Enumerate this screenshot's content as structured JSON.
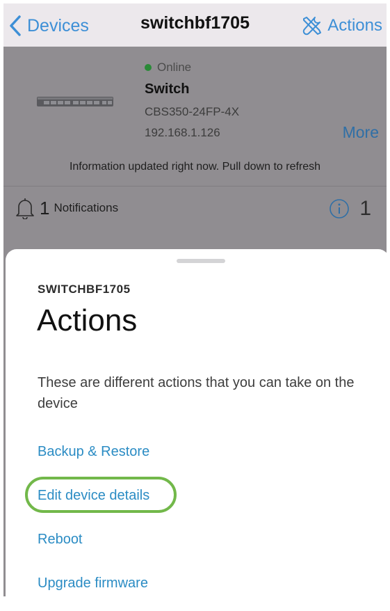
{
  "nav": {
    "back_label": "Devices",
    "title": "switchbf1705",
    "actions_label": "Actions"
  },
  "device": {
    "status": "Online",
    "type": "Switch",
    "model": "CBS350-24FP-4X",
    "ip": "192.168.1.126",
    "more_label": "More",
    "info_updated": "Information updated right now. Pull down to refresh"
  },
  "notifications": {
    "count": "1",
    "label": "Notifications",
    "info_count": "1"
  },
  "sheet": {
    "subtitle": "SWITCHBF1705",
    "title": "Actions",
    "description": "These are different actions that you can take on the device",
    "actions": [
      {
        "label": "Backup & Restore"
      },
      {
        "label": "Edit device details",
        "highlighted": true
      },
      {
        "label": "Reboot"
      },
      {
        "label": "Upgrade firmware"
      }
    ]
  },
  "colors": {
    "accent": "#3d8fd6",
    "link": "#2b8cc4",
    "highlight": "#72b84a",
    "status_online": "#2a8a37",
    "nav_background": "#ece8ec",
    "dimmed_background": "#908d91"
  },
  "icons": {
    "back": "chevron-left-icon",
    "actions": "tools-icon",
    "notifications": "bell-icon",
    "info": "info-icon"
  }
}
